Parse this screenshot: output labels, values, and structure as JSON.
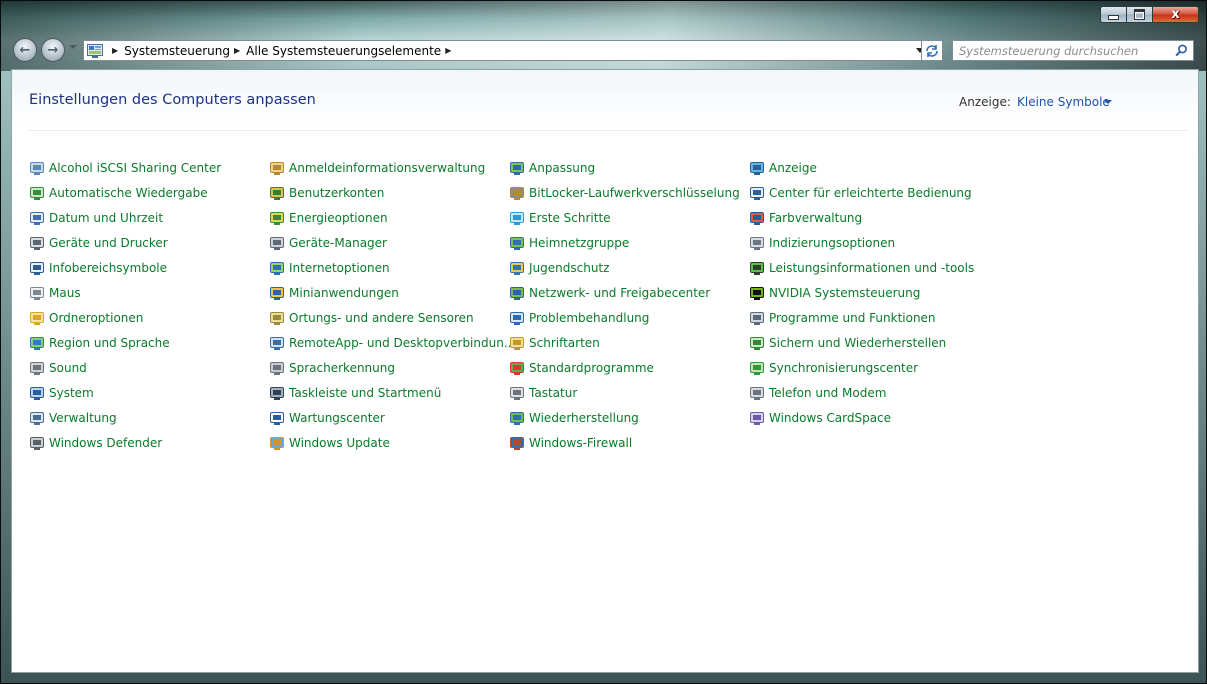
{
  "window": {
    "caption_close": "x",
    "caption_restore": "",
    "caption_minimize": ""
  },
  "navigation": {
    "back_arrow": "←",
    "forward_arrow": "→",
    "breadcrumbs": [
      "Systemsteuerung",
      "Alle Systemsteuerungselemente"
    ],
    "search_placeholder": "Systemsteuerung durchsuchen"
  },
  "header": {
    "title": "Einstellungen des Computers anpassen",
    "view_label": "Anzeige:",
    "view_value": "Kleine Symbole"
  },
  "columns": [
    [
      {
        "label": "Alcohol iSCSI Sharing Center",
        "icon": "network-share-icon"
      },
      {
        "label": "Automatische Wiedergabe",
        "icon": "autoplay-icon"
      },
      {
        "label": "Datum und Uhrzeit",
        "icon": "clock-icon"
      },
      {
        "label": "Geräte und Drucker",
        "icon": "printer-icon"
      },
      {
        "label": "Infobereichsymbole",
        "icon": "notification-area-icon"
      },
      {
        "label": "Maus",
        "icon": "mouse-icon"
      },
      {
        "label": "Ordneroptionen",
        "icon": "folder-options-icon"
      },
      {
        "label": "Region und Sprache",
        "icon": "globe-icon"
      },
      {
        "label": "Sound",
        "icon": "speaker-icon"
      },
      {
        "label": "System",
        "icon": "system-icon"
      },
      {
        "label": "Verwaltung",
        "icon": "admin-tools-icon"
      },
      {
        "label": "Windows Defender",
        "icon": "defender-icon"
      }
    ],
    [
      {
        "label": "Anmeldeinformationsverwaltung",
        "icon": "credential-vault-icon"
      },
      {
        "label": "Benutzerkonten",
        "icon": "users-icon"
      },
      {
        "label": "Energieoptionen",
        "icon": "power-icon"
      },
      {
        "label": "Geräte-Manager",
        "icon": "device-manager-icon"
      },
      {
        "label": "Internetoptionen",
        "icon": "internet-options-icon"
      },
      {
        "label": "Minianwendungen",
        "icon": "gadgets-icon"
      },
      {
        "label": "Ortungs- und andere Sensoren",
        "icon": "sensor-icon"
      },
      {
        "label": "RemoteApp- und Desktopverbindun...",
        "icon": "remoteapp-icon"
      },
      {
        "label": "Spracherkennung",
        "icon": "microphone-icon"
      },
      {
        "label": "Taskleiste und Startmenü",
        "icon": "taskbar-icon"
      },
      {
        "label": "Wartungscenter",
        "icon": "action-center-flag-icon"
      },
      {
        "label": "Windows Update",
        "icon": "windows-update-icon"
      }
    ],
    [
      {
        "label": "Anpassung",
        "icon": "personalization-icon"
      },
      {
        "label": "BitLocker-Laufwerkverschlüsselung",
        "icon": "bitlocker-key-icon"
      },
      {
        "label": "Erste Schritte",
        "icon": "getting-started-icon"
      },
      {
        "label": "Heimnetzgruppe",
        "icon": "homegroup-icon"
      },
      {
        "label": "Jugendschutz",
        "icon": "parental-controls-icon"
      },
      {
        "label": "Netzwerk- und Freigabecenter",
        "icon": "network-center-icon"
      },
      {
        "label": "Problembehandlung",
        "icon": "troubleshooting-icon"
      },
      {
        "label": "Schriftarten",
        "icon": "fonts-icon"
      },
      {
        "label": "Standardprogramme",
        "icon": "default-programs-icon"
      },
      {
        "label": "Tastatur",
        "icon": "keyboard-icon"
      },
      {
        "label": "Wiederherstellung",
        "icon": "recovery-icon"
      },
      {
        "label": "Windows-Firewall",
        "icon": "firewall-icon"
      }
    ],
    [
      {
        "label": "Anzeige",
        "icon": "display-icon"
      },
      {
        "label": "Center für erleichterte Bedienung",
        "icon": "ease-of-access-icon"
      },
      {
        "label": "Farbverwaltung",
        "icon": "color-management-icon"
      },
      {
        "label": "Indizierungsoptionen",
        "icon": "indexing-icon"
      },
      {
        "label": "Leistungsinformationen und -tools",
        "icon": "performance-icon"
      },
      {
        "label": "NVIDIA Systemsteuerung",
        "icon": "nvidia-icon"
      },
      {
        "label": "Programme und Funktionen",
        "icon": "programs-features-icon"
      },
      {
        "label": "Sichern und Wiederherstellen",
        "icon": "backup-restore-icon"
      },
      {
        "label": "Synchronisierungscenter",
        "icon": "sync-center-icon"
      },
      {
        "label": "Telefon und Modem",
        "icon": "phone-modem-icon"
      },
      {
        "label": "Windows CardSpace",
        "icon": "cardspace-icon"
      }
    ]
  ]
}
